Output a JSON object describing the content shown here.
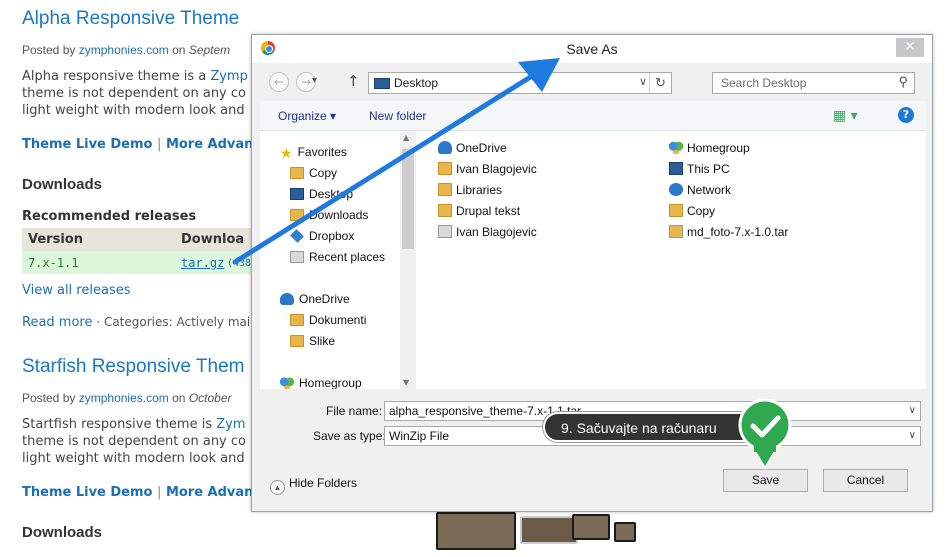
{
  "background": {
    "post1": {
      "title": "Alpha Responsive Theme",
      "posted_prefix": "Posted by",
      "author": "zymphonies.com",
      "on": "on",
      "date": "Septem",
      "desc_line1_pre": "Alpha responsive theme is a ",
      "desc_line1_link": "Zymp",
      "desc_line2": "theme is not dependent on any co",
      "desc_line3": "light weight with modern look and",
      "link_demo": "Theme Live Demo",
      "sep": "|",
      "link_more": "More Advan"
    },
    "downloads_heading": "Downloads",
    "recommended": "Recommended releases",
    "table": {
      "col_version": "Version",
      "col_download": "Downloa",
      "row_version": "7.x-1.1",
      "row_download": "tar.gz",
      "row_size": "(438"
    },
    "view_all": "View all releases",
    "read_more": "Read more",
    "categories": "· Categories:  Actively mai",
    "post2": {
      "title": "Starfish Responsive Them",
      "posted_prefix": "Posted by",
      "author": "zymphonies.com",
      "on": "on",
      "date": "October",
      "desc_line1_pre": "Startfish responsive theme is ",
      "desc_line1_link": "Zym",
      "desc_line2": "theme is not dependent on any co",
      "desc_line3": "light weight with modern look and",
      "link_demo": "Theme Live Demo",
      "sep": "|",
      "link_more": "More Advan"
    },
    "downloads_heading_2": "Downloads"
  },
  "dialog": {
    "title": "Save As",
    "close_glyph": "✕",
    "address": "Desktop",
    "search_placeholder": "Search Desktop",
    "toolbar": {
      "organize": "Organize ▾",
      "new_folder": "New folder",
      "views_glyph": "▦ ▾",
      "help_glyph": "?"
    },
    "nav_items": [
      {
        "label": "Favorites",
        "icon": "star-icon"
      },
      {
        "label": "Copy",
        "icon": "folder-icon"
      },
      {
        "label": "Desktop",
        "icon": "desktop-icon"
      },
      {
        "label": "Downloads",
        "icon": "downloads-folder-icon"
      },
      {
        "label": "Dropbox",
        "icon": "dropbox-icon"
      },
      {
        "label": "Recent places",
        "icon": "recent-places-icon"
      },
      {
        "label": "OneDrive",
        "icon": "onedrive-icon"
      },
      {
        "label": "Dokumenti",
        "icon": "folder-icon"
      },
      {
        "label": "Slike",
        "icon": "folder-icon"
      },
      {
        "label": "Homegroup",
        "icon": "homegroup-icon"
      }
    ],
    "files_col1": [
      {
        "label": "OneDrive",
        "icon": "onedrive-icon"
      },
      {
        "label": "Ivan Blagojevic",
        "icon": "user-folder-icon"
      },
      {
        "label": "Libraries",
        "icon": "libraries-icon"
      },
      {
        "label": "Drupal tekst",
        "icon": "folder-icon"
      },
      {
        "label": "Ivan Blagojevic",
        "icon": "shortcut-icon"
      }
    ],
    "files_col2": [
      {
        "label": "Homegroup",
        "icon": "homegroup-icon"
      },
      {
        "label": "This PC",
        "icon": "pc-icon"
      },
      {
        "label": "Network",
        "icon": "network-icon"
      },
      {
        "label": "Copy",
        "icon": "copy-folder-icon"
      },
      {
        "label": "md_foto-7.x-1.0.tar",
        "icon": "archive-icon"
      }
    ],
    "file_name_label": "File name:",
    "file_name_value": "alpha_responsive_theme-7.x-1.1.tar",
    "save_type_label": "Save as type:",
    "save_type_value": "WinZip File",
    "hide_folders": "Hide Folders",
    "save_button": "Save",
    "cancel_button": "Cancel"
  },
  "callout": {
    "text": "9. Sačuvajte na računaru"
  },
  "colors": {
    "accent_arrow": "#1f7ae0",
    "check_green": "#2fa84f",
    "link_blue": "#1a6fb3"
  }
}
